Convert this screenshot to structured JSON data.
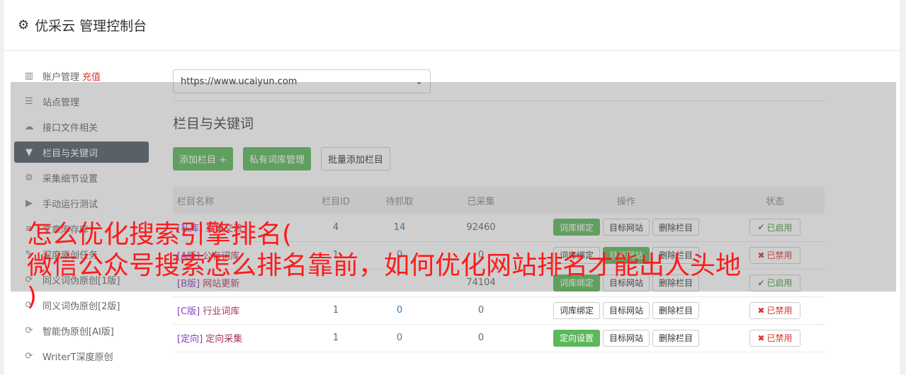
{
  "header": {
    "title": "优采云 管理控制台",
    "icon": "gear-icon"
  },
  "sidebar": {
    "items": [
      {
        "label": "账户管理",
        "icon": "bar-chart-icon",
        "extra": "充值"
      },
      {
        "label": "站点管理",
        "icon": "server-icon"
      },
      {
        "label": "接口文件相关",
        "icon": "cloud-upload-icon"
      },
      {
        "label": "栏目与关键词",
        "icon": "filter-icon",
        "active": true
      },
      {
        "label": "采集细节设置",
        "icon": "cogs-icon"
      },
      {
        "label": "手动运行测试",
        "icon": "play-icon"
      },
      {
        "label": "文章库存库",
        "icon": "database-icon"
      },
      {
        "label": "深度原创任务",
        "icon": "edit-icon"
      },
      {
        "label": "同义词伪原创[1版]",
        "icon": "refresh-icon"
      },
      {
        "label": "同义词伪原创[2版]",
        "icon": "refresh-icon"
      },
      {
        "label": "智能伪原创[AI版]",
        "icon": "refresh-icon"
      },
      {
        "label": "WriterT深度原创",
        "icon": "refresh-icon"
      }
    ]
  },
  "site_select": {
    "value": "https://www.ucaiyun.com"
  },
  "section": {
    "title": "栏目与关键词"
  },
  "toolbar": {
    "add_label": "添加栏目 +",
    "private_label": "私有词库管理",
    "batch_label": "批量添加栏目"
  },
  "table": {
    "headers": [
      "栏目名称",
      "栏目ID",
      "待抓取",
      "已采集",
      "操作",
      "状态"
    ],
    "rows": [
      {
        "tag": "[私库]",
        "name": "采集交流",
        "id": "4",
        "pending": "14",
        "collected": "92460",
        "op1": "词库绑定",
        "op1_green": true,
        "op2": "目标网站",
        "op2_green": false,
        "op3": "删除栏目",
        "status": "已启用",
        "on": true
      },
      {
        "tag": "[A版]",
        "name": "公有词库",
        "id": "1",
        "pending": "0",
        "collected": "0",
        "op1": "词库绑定",
        "op1_green": false,
        "op2": "目标网站",
        "op2_green": true,
        "op3": "删除栏目",
        "status": "已禁用",
        "on": false
      },
      {
        "tag": "[B版]",
        "name": "网站更新",
        "id": "",
        "pending": "",
        "collected": "74104",
        "op1": "词库绑定",
        "op1_green": true,
        "op2": "目标网站",
        "op2_green": false,
        "op3": "删除栏目",
        "status": "已启用",
        "on": true
      },
      {
        "tag": "[C版]",
        "name": "行业词库",
        "id": "1",
        "pending": "0",
        "collected": "0",
        "op1": "词库绑定",
        "op1_green": false,
        "op2": "目标网站",
        "op2_green": false,
        "op3": "删除栏目",
        "status": "已禁用",
        "on": false
      },
      {
        "tag": "[定向]",
        "name": "定向采集",
        "id": "1",
        "pending": "0",
        "collected": "0",
        "op1": "定向设置",
        "op1_green": true,
        "op2": "目标网站",
        "op2_green": false,
        "op3": "删除栏目",
        "status": "已禁用",
        "on": false
      }
    ]
  },
  "overlay_text": {
    "line1": "怎么优化搜索引擎排名(",
    "line2": "微信公众号搜索怎么排名靠前，如何优化网站排名才能出人头地",
    "line3": ")"
  }
}
